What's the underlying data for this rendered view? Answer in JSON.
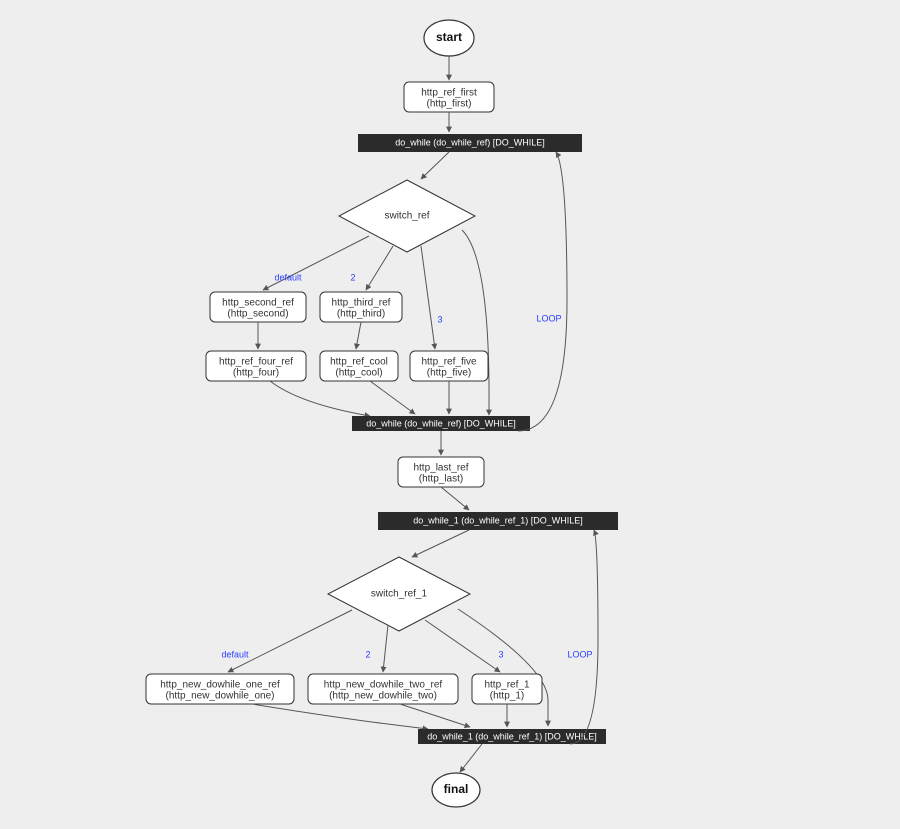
{
  "terminals": {
    "start": "start",
    "final": "final"
  },
  "procs": {
    "http_ref_first": {
      "line1": "http_ref_first",
      "line2": "(http_first)"
    },
    "http_second_ref": {
      "line1": "http_second_ref",
      "line2": "(http_second)"
    },
    "http_third_ref": {
      "line1": "http_third_ref",
      "line2": "(http_third)"
    },
    "http_ref_four_ref": {
      "line1": "http_ref_four_ref",
      "line2": "(http_four)"
    },
    "http_ref_cool": {
      "line1": "http_ref_cool",
      "line2": "(http_cool)"
    },
    "http_ref_five": {
      "line1": "http_ref_five",
      "line2": "(http_five)"
    },
    "http_last_ref": {
      "line1": "http_last_ref",
      "line2": "(http_last)"
    },
    "http_new_dowhile_one_ref": {
      "line1": "http_new_dowhile_one_ref",
      "line2": "(http_new_dowhile_one)"
    },
    "http_new_dowhile_two_ref": {
      "line1": "http_new_dowhile_two_ref",
      "line2": "(http_new_dowhile_two)"
    },
    "http_ref_1": {
      "line1": "http_ref_1",
      "line2": "(http_1)"
    }
  },
  "bars": {
    "do_while_top": "do_while (do_while_ref) [DO_WHILE]",
    "do_while_bottom": "do_while (do_while_ref) [DO_WHILE]",
    "do_while_1_top": "do_while_1 (do_while_ref_1) [DO_WHILE]",
    "do_while_1_bottom": "do_while_1 (do_while_ref_1) [DO_WHILE]"
  },
  "diamonds": {
    "switch_ref": "switch_ref",
    "switch_ref_1": "switch_ref_1"
  },
  "edge_labels": {
    "default": "default",
    "two": "2",
    "three": "3",
    "loop": "LOOP"
  }
}
